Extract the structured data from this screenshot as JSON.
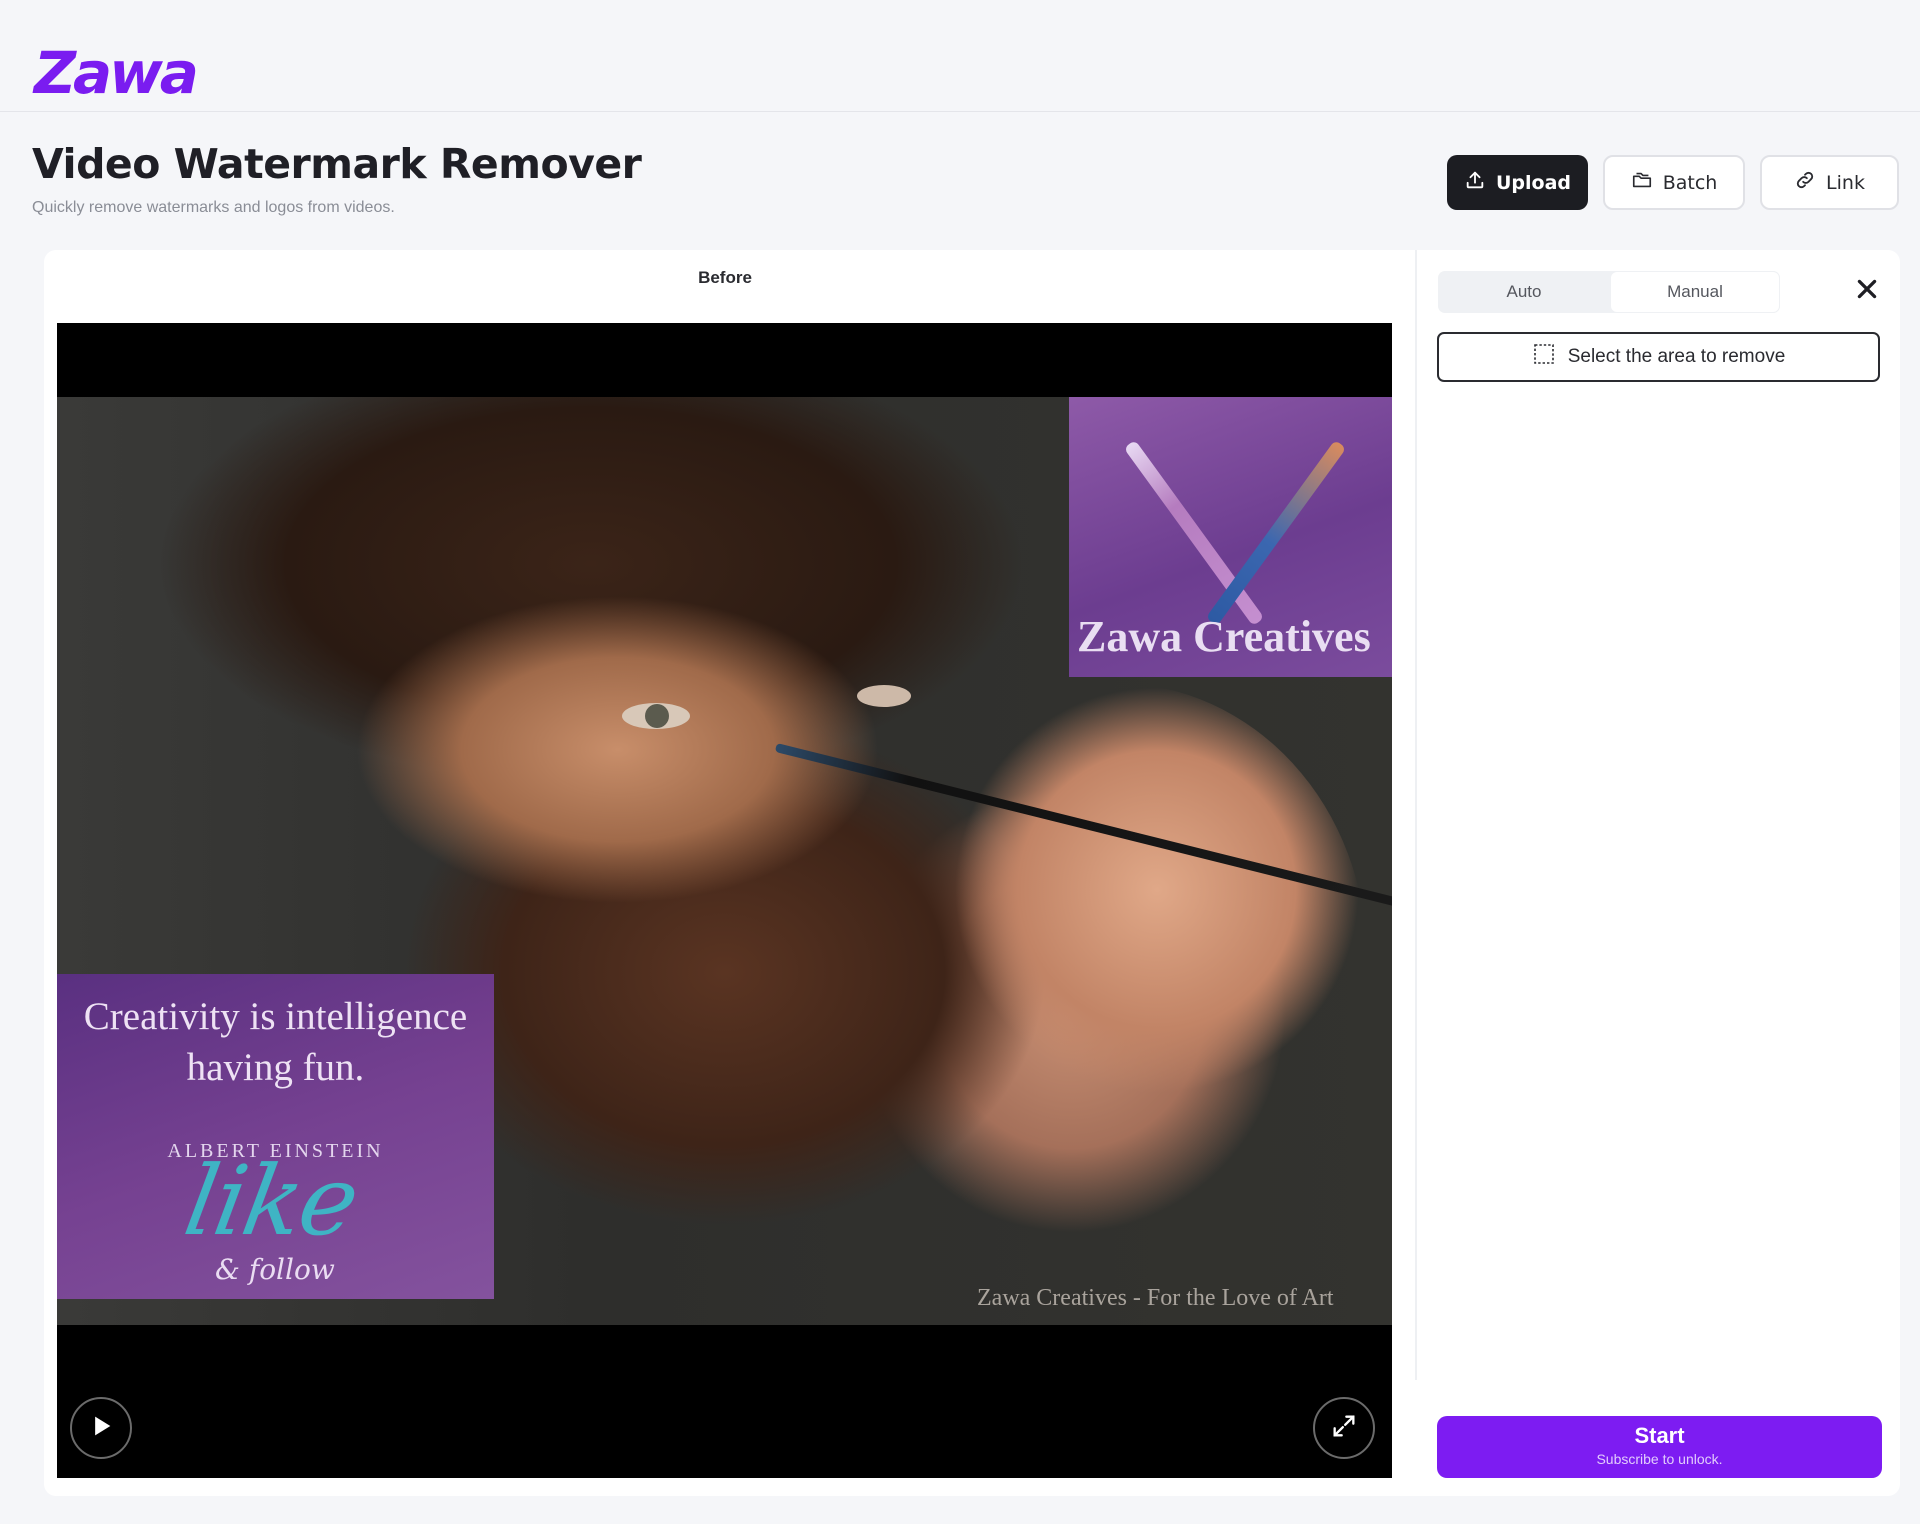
{
  "app": {
    "logo": "Zawa"
  },
  "header": {
    "title": "Video Watermark Remover",
    "subtitle": "Quickly remove watermarks and logos from videos."
  },
  "toolbar": {
    "upload_label": "Upload",
    "batch_label": "Batch",
    "link_label": "Link"
  },
  "preview": {
    "label": "Before",
    "brand_overlay_text": "Zawa Creatives",
    "quote_line_1": "Creativity is intelligence",
    "quote_line_2": "having fun.",
    "quote_author": "ALBERT EINSTEIN",
    "like_text": "like",
    "follow_text": "& follow",
    "caption_watermark": "Zawa Creatives - For the Love of Art"
  },
  "panel": {
    "tabs": [
      {
        "label": "Auto"
      },
      {
        "label": "Manual"
      }
    ],
    "active_tab": "Manual",
    "select_area_label": "Select the area to remove",
    "start_label": "Start",
    "start_sublabel": "Subscribe to unlock."
  },
  "colors": {
    "accent": "#7d1cf2",
    "dark_button": "#1c1d22"
  },
  "icons": {
    "upload": "upload-icon",
    "batch": "folder-stack-icon",
    "link": "link-icon",
    "close": "close-icon",
    "select": "dashed-selection-icon",
    "play": "play-icon",
    "fullscreen": "fullscreen-icon"
  }
}
